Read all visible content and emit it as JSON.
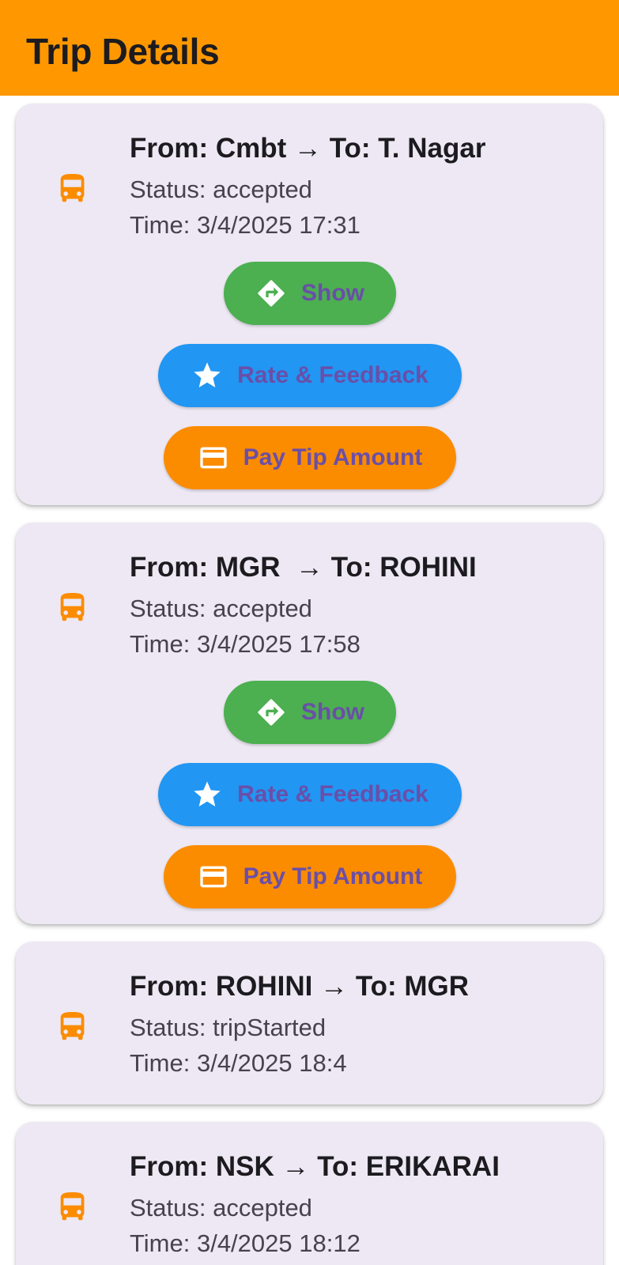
{
  "appbar": {
    "title": "Trip Details"
  },
  "colors": {
    "appbar": "#ff9800",
    "card_background": "#ede8f3",
    "bus_icon": "#fb8c00",
    "show_button": "#4caf50",
    "rate_button": "#2196f3",
    "pay_button": "#fb8c00",
    "button_label": "#6a4fa8"
  },
  "trips": [
    {
      "title": "From: Cmbt → To: T. Nagar",
      "status": "Status: accepted",
      "time": "Time: 3/4/2025 17:31",
      "icon": "bus-icon",
      "actions": {
        "show": {
          "label": "Show",
          "icon": "directions-icon"
        },
        "rate": {
          "label": "Rate & Feedback",
          "icon": "star-icon"
        },
        "pay": {
          "label": "Pay Tip Amount",
          "icon": "credit-card-icon"
        }
      }
    },
    {
      "title": "From: MGR  → To: ROHINI",
      "status": "Status: accepted",
      "time": "Time: 3/4/2025 17:58",
      "icon": "bus-icon",
      "actions": {
        "show": {
          "label": "Show",
          "icon": "directions-icon"
        },
        "rate": {
          "label": "Rate & Feedback",
          "icon": "star-icon"
        },
        "pay": {
          "label": "Pay Tip Amount",
          "icon": "credit-card-icon"
        }
      }
    },
    {
      "title": "From: ROHINI → To: MGR",
      "status": "Status: tripStarted",
      "time": "Time: 3/4/2025 18:4",
      "icon": "bus-icon"
    },
    {
      "title": "From: NSK → To: ERIKARAI",
      "status": "Status: accepted",
      "time": "Time: 3/4/2025 18:12",
      "icon": "bus-icon"
    }
  ]
}
